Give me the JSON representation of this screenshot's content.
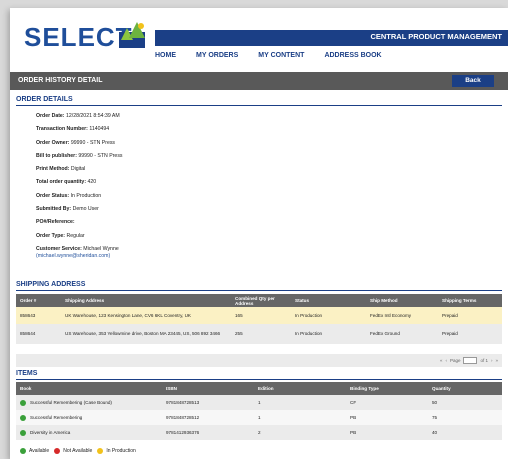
{
  "brand": {
    "logo_text": "SELECT",
    "top_title": "CENTRAL PRODUCT MANAGEMENT"
  },
  "nav": {
    "items": [
      "HOME",
      "MY ORDERS",
      "MY CONTENT",
      "ADDRESS BOOK"
    ]
  },
  "section": {
    "title": "ORDER HISTORY DETAIL",
    "back_label": "Back"
  },
  "order_details": {
    "heading": "ORDER DETAILS",
    "rows": [
      {
        "label": "Order Date:",
        "value": "12/28/2021 8:54:39 AM"
      },
      {
        "label": "Transaction Number:",
        "value": "1140494"
      },
      {
        "label": "Order Owner:",
        "value": "99990 - STN Press"
      },
      {
        "label": "Bill to publisher:",
        "value": "99990 - STN Press"
      },
      {
        "label": "Print Method:",
        "value": "Digital"
      },
      {
        "label": "Total order quantity:",
        "value": "420"
      },
      {
        "label": "Order Status:",
        "value": "In Production"
      },
      {
        "label": "Submitted By:",
        "value": "Demo User"
      },
      {
        "label": "PO#/Reference:",
        "value": ""
      },
      {
        "label": "Order Type:",
        "value": "Regular"
      }
    ],
    "customer_service_label": "Customer Service:",
    "customer_service_name": "Michael Wynne",
    "customer_service_email": "(michael.wynne@sheridan.com)"
  },
  "shipping": {
    "heading": "SHIPPING ADDRESS",
    "columns": [
      "Order #",
      "Shipping Address",
      "Combined Qty per Address",
      "Status",
      "Ship Method",
      "Shipping Terms"
    ],
    "rows": [
      [
        "858643",
        "UK Warehouse, 123 Kensington Lane, CV6 6KL Coventry, UK",
        "165",
        "In Production",
        "FedEx Intl Economy",
        "Prepaid"
      ],
      [
        "858644",
        "US Warehouse, 353 Yellowmine drive, Boston MA 23445, US, 506 892 3466",
        "255",
        "In Production",
        "FedEx Ground",
        "Prepaid"
      ]
    ],
    "pager": {
      "page_label": "Page",
      "page_value": "1",
      "of_label": "of 1"
    }
  },
  "items": {
    "heading": "ITEMS",
    "columns": [
      "Book",
      "ISBN",
      "Edition",
      "Binding Type",
      "Quantity"
    ],
    "rows": [
      {
        "status": "available",
        "cells": [
          "Successful Remembering (Case Bound)",
          "9781848728513",
          "1",
          "CF",
          "50"
        ]
      },
      {
        "status": "available",
        "cells": [
          "Successful Remembering",
          "9781848728512",
          "1",
          "PB",
          "75"
        ]
      },
      {
        "status": "available",
        "cells": [
          "Diversity in America",
          "9781412936376",
          "2",
          "PB",
          "40"
        ]
      }
    ]
  },
  "legend": {
    "available": "Available",
    "not_available": "Not Available",
    "in_production": "In Production"
  },
  "colors": {
    "navy": "#1b3f86",
    "available": "#3aa03a",
    "not_available": "#d62a2a",
    "in_production": "#f2c21b"
  }
}
